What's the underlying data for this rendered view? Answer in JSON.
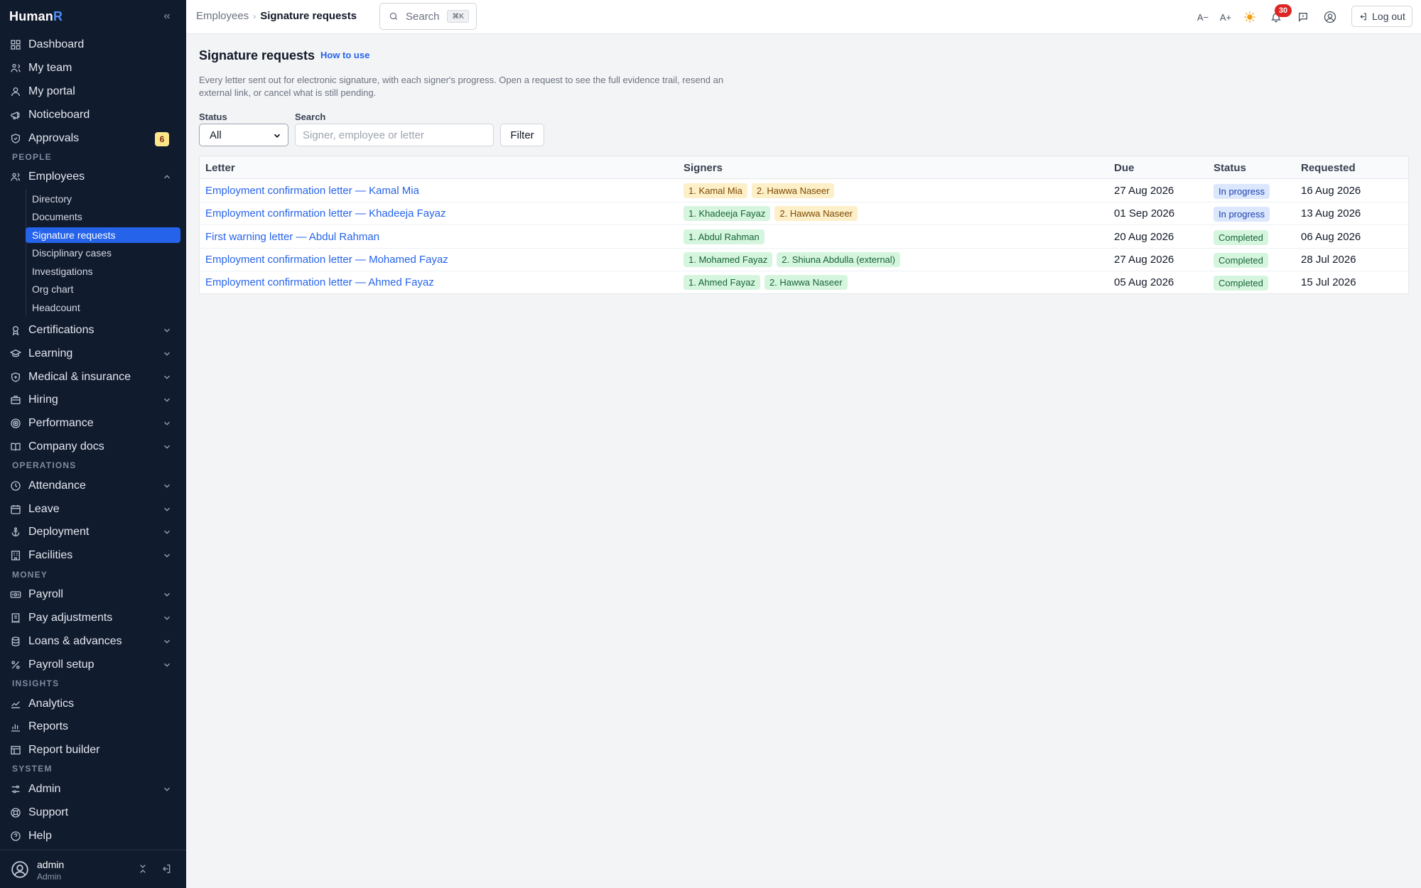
{
  "app": {
    "brand_main": "Human",
    "brand_accent": "R",
    "accent_color": "#2563eb"
  },
  "sidebar": {
    "top_items": [
      {
        "label": "Dashboard",
        "icon": "grid-icon"
      },
      {
        "label": "My team",
        "icon": "team-icon"
      },
      {
        "label": "My portal",
        "icon": "user-icon"
      },
      {
        "label": "Noticeboard",
        "icon": "megaphone-icon"
      },
      {
        "label": "Approvals",
        "icon": "shield-check-icon",
        "badge": "6"
      }
    ],
    "sections": {
      "people": "PEOPLE",
      "operations": "OPERATIONS",
      "money": "MONEY",
      "insights": "INSIGHTS",
      "system": "SYSTEM"
    },
    "employees": {
      "label": "Employees",
      "children": [
        "Directory",
        "Documents",
        "Signature requests",
        "Disciplinary cases",
        "Investigations",
        "Org chart",
        "Headcount"
      ],
      "active": "Signature requests"
    },
    "people_items": [
      {
        "label": "Certifications",
        "icon": "award-icon"
      },
      {
        "label": "Learning",
        "icon": "graduation-cap-icon"
      },
      {
        "label": "Medical & insurance",
        "icon": "shield-plus-icon"
      },
      {
        "label": "Hiring",
        "icon": "briefcase-icon"
      },
      {
        "label": "Performance",
        "icon": "target-icon"
      },
      {
        "label": "Company docs",
        "icon": "book-icon"
      }
    ],
    "operations_items": [
      {
        "label": "Attendance",
        "icon": "clock-icon"
      },
      {
        "label": "Leave",
        "icon": "calendar-icon"
      },
      {
        "label": "Deployment",
        "icon": "anchor-icon"
      },
      {
        "label": "Facilities",
        "icon": "building-icon"
      }
    ],
    "money_items": [
      {
        "label": "Payroll",
        "icon": "banknote-icon"
      },
      {
        "label": "Pay adjustments",
        "icon": "receipt-icon"
      },
      {
        "label": "Loans & advances",
        "icon": "coins-icon"
      },
      {
        "label": "Payroll setup",
        "icon": "percent-icon"
      }
    ],
    "insights_items": [
      {
        "label": "Analytics",
        "icon": "trend-icon"
      },
      {
        "label": "Reports",
        "icon": "bar-chart-icon"
      },
      {
        "label": "Report builder",
        "icon": "table-icon"
      }
    ],
    "system_items": [
      {
        "label": "Admin",
        "icon": "sliders-icon"
      },
      {
        "label": "Support",
        "icon": "lifebuoy-icon"
      },
      {
        "label": "Help",
        "icon": "help-circle-icon"
      }
    ],
    "user": {
      "name": "admin",
      "role": "Admin"
    }
  },
  "topbar": {
    "breadcrumb_parent": "Employees",
    "breadcrumb_current": "Signature requests",
    "search_label": "Search",
    "search_shortcut": "⌘K",
    "font_decrease": "A−",
    "font_increase": "A+",
    "notification_count": "30",
    "logout_label": "Log out"
  },
  "page": {
    "title": "Signature requests",
    "how_to_use": "How to use",
    "description": "Every letter sent out for electronic signature, with each signer's progress. Open a request to see the full evidence trail, resend an external link, or cancel what is still pending.",
    "filters": {
      "status_label": "Status",
      "status_value": "All",
      "search_label": "Search",
      "search_placeholder": "Signer, employee or letter",
      "filter_button": "Filter"
    },
    "table": {
      "headers": [
        "Letter",
        "Signers",
        "Due",
        "Status",
        "Requested"
      ],
      "rows": [
        {
          "letter": "Employment confirmation letter — Kamal Mia",
          "signers": [
            {
              "name": "1. Kamal Mia",
              "state": "pending"
            },
            {
              "name": "2. Hawwa Naseer",
              "state": "pending"
            }
          ],
          "due": "27 Aug 2026",
          "status": "In progress",
          "status_kind": "progress",
          "requested": "16 Aug 2026"
        },
        {
          "letter": "Employment confirmation letter — Khadeeja Fayaz",
          "signers": [
            {
              "name": "1. Khadeeja Fayaz",
              "state": "signed"
            },
            {
              "name": "2. Hawwa Naseer",
              "state": "pending"
            }
          ],
          "due": "01 Sep 2026",
          "status": "In progress",
          "status_kind": "progress",
          "requested": "13 Aug 2026"
        },
        {
          "letter": "First warning letter — Abdul Rahman",
          "signers": [
            {
              "name": "1. Abdul Rahman",
              "state": "signed"
            }
          ],
          "due": "20 Aug 2026",
          "status": "Completed",
          "status_kind": "done",
          "requested": "06 Aug 2026"
        },
        {
          "letter": "Employment confirmation letter — Mohamed Fayaz",
          "signers": [
            {
              "name": "1. Mohamed Fayaz",
              "state": "signed"
            },
            {
              "name": "2. Shiuna Abdulla (external)",
              "state": "signed"
            }
          ],
          "due": "27 Aug 2026",
          "status": "Completed",
          "status_kind": "done",
          "requested": "28 Jul 2026"
        },
        {
          "letter": "Employment confirmation letter — Ahmed Fayaz",
          "signers": [
            {
              "name": "1. Ahmed Fayaz",
              "state": "signed"
            },
            {
              "name": "2. Hawwa Naseer",
              "state": "signed"
            }
          ],
          "due": "05 Aug 2026",
          "status": "Completed",
          "status_kind": "done",
          "requested": "15 Jul 2026"
        }
      ]
    }
  }
}
